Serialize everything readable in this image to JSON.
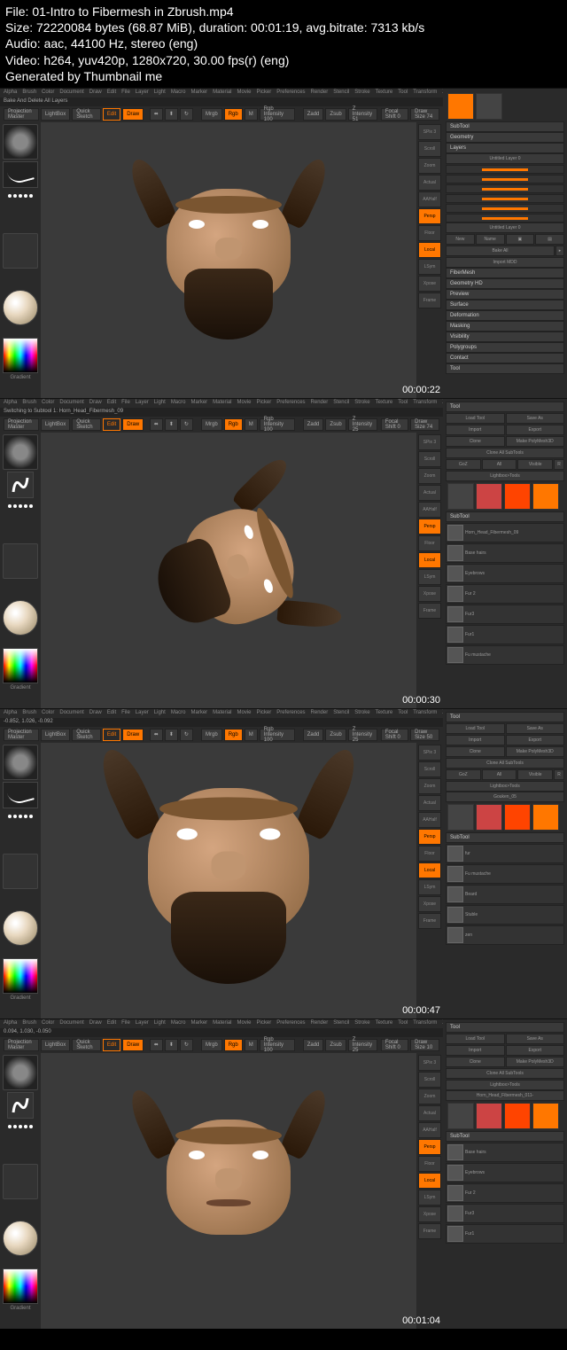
{
  "header": {
    "file": "File: 01-Intro to Fibermesh in Zbrush.mp4",
    "size": "Size: 72220084 bytes (68.87 MiB), duration: 00:01:19, avg.bitrate: 7313 kb/s",
    "audio": "Audio: aac, 44100 Hz, stereo (eng)",
    "video": "Video: h264, yuv420p, 1280x720, 30.00 fps(r) (eng)",
    "gen": "Generated by Thumbnail me"
  },
  "menu": [
    "Alpha",
    "Brush",
    "Color",
    "Document",
    "Draw",
    "Edit",
    "File",
    "Layer",
    "Light",
    "Macro",
    "Marker",
    "Material",
    "Movie",
    "Picker",
    "Preferences",
    "Render",
    "Stencil",
    "Stroke",
    "Texture",
    "Tool",
    "Transform",
    "Zplugin",
    "Zscript"
  ],
  "frames": [
    {
      "status": "Bake And Delete All Layers",
      "toolbar": {
        "proj": "Projection Master",
        "lightbox": "LightBox",
        "sketch": "Quick Sketch",
        "edit": "Edit",
        "draw": "Draw",
        "mrgb": "Mrgb",
        "rgb": "Rgb",
        "m": "M",
        "rgbint": "Rgb Intensity 100",
        "zadd": "Zadd",
        "zsub": "Zsub",
        "zint": "Z Intensity 51",
        "focal": "Focal Shift 0",
        "dsize": "Draw Size 74"
      },
      "timestamp": "00:00:22",
      "panel": {
        "subtool": "SubTool",
        "geometry": "Geometry",
        "layers": "Layers",
        "untitled": "Untitled Layer 0",
        "new": "New",
        "name": "Name",
        "bake": "Bake All",
        "import": "Import MDD",
        "sections": [
          "FiberMesh",
          "Geometry HD",
          "Preview",
          "Surface",
          "Deformation",
          "Masking",
          "Visibility",
          "Polygroups",
          "Contact",
          "Tool"
        ]
      }
    },
    {
      "status": "Switching to Subtool 1: Horn_Head_Fibermesh_09",
      "toolbar": {
        "proj": "Projection Master",
        "lightbox": "LightBox",
        "sketch": "Quick Sketch",
        "edit": "Edit",
        "draw": "Draw",
        "mrgb": "Mrgb",
        "rgb": "Rgb",
        "m": "M",
        "rgbint": "Rgb Intensity 100",
        "zadd": "Zadd",
        "zsub": "Zsub",
        "zint": "Z Intensity 25",
        "focal": "Focal Shift 0",
        "dsize": "Draw Size 74"
      },
      "timestamp": "00:00:30",
      "panel": {
        "tool": "Tool",
        "load": "Load Tool",
        "save": "Save As",
        "import": "Import",
        "export": "Export",
        "clone": "Clone",
        "make": "Make PolyMesh3D",
        "cloneall": "Clone All SubTools",
        "goz": "GoZ",
        "all": "All",
        "visible": "Visible",
        "r": "R",
        "lbtools": "Lightbox>Tools",
        "subtool": "SubTool",
        "subtools": [
          "Horn_Head_Fibermesh_09",
          "Base hairs",
          "Eyebrows",
          "Fur 2",
          "Fur3",
          "Fur1",
          "Fu mustache"
        ]
      }
    },
    {
      "coords": "-0.852, 1.026, -0.092",
      "toolbar": {
        "proj": "Projection Master",
        "lightbox": "LightBox",
        "sketch": "Quick Sketch",
        "edit": "Edit",
        "draw": "Draw",
        "mrgb": "Mrgb",
        "rgb": "Rgb",
        "m": "M",
        "rgbint": "Rgb Intensity 100",
        "zadd": "Zadd",
        "zsub": "Zsub",
        "zint": "Z Intensity 25",
        "focal": "Focal Shift 0",
        "dsize": "Draw Size 50"
      },
      "timestamp": "00:00:47",
      "panel": {
        "tool": "Tool",
        "load": "Load Tool",
        "save": "Save As",
        "import": "Import",
        "export": "Export",
        "clone": "Clone",
        "make": "Make PolyMesh3D",
        "cloneall": "Clone All SubTools",
        "goz": "GoZ",
        "all": "All",
        "visible": "Visible",
        "r": "R",
        "lbtools": "Lightbox>Tools",
        "gouken": "Gouken_05",
        "subtool": "SubTool",
        "subtools": [
          "fur",
          "Fu mustache",
          "Beard",
          "Stuble",
          "zen"
        ]
      }
    },
    {
      "coords": "0.094, 1.030, -0.050",
      "toolbar": {
        "proj": "Projection Master",
        "lightbox": "LightBox",
        "sketch": "Quick Sketch",
        "edit": "Edit",
        "draw": "Draw",
        "mrgb": "Mrgb",
        "rgb": "Rgb",
        "m": "M",
        "rgbint": "Rgb Intensity 100",
        "zadd": "Zadd",
        "zsub": "Zsub",
        "zint": "Z Intensity 25",
        "focal": "Focal Shift 0",
        "dsize": "Draw Size 10"
      },
      "timestamp": "00:01:04",
      "panel": {
        "tool": "Tool",
        "load": "Load Tool",
        "save": "Save As",
        "import": "Import",
        "export": "Export",
        "clone": "Clone",
        "make": "Make PolyMesh3D",
        "cloneall": "Clone All SubTools",
        "lbtools": "Lightbox>Tools",
        "name": "Horn_Head_Fibermesh_011-",
        "subtool": "SubTool",
        "subtools": [
          "Base hairs",
          "Eyebrows",
          "Fur 2",
          "Fur3",
          "Fur1"
        ]
      }
    }
  ],
  "rtools": [
    "SPix 3",
    "Scroll",
    "Zoom",
    "Actual",
    "AAHalf",
    "Persp",
    "Floor",
    "Local",
    "LSym",
    "Xpose",
    "Frame"
  ]
}
